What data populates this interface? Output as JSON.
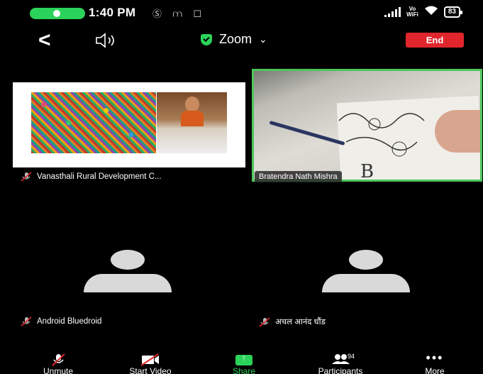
{
  "status_bar": {
    "time": "1:40 PM",
    "left_icons": "Ⓢ ⩋ ☐",
    "vowifi_top": "Vo",
    "vowifi_bottom": "WiFi",
    "battery": "83"
  },
  "header": {
    "title": "Zoom",
    "end_label": "End",
    "accent_green": "#2bd35a",
    "end_red": "#e0262c"
  },
  "tiles": [
    {
      "name": "Vanasthali Rural Development C...",
      "muted": true,
      "active_speaker": false
    },
    {
      "name": "Bratendra Nath Mishra",
      "muted": false,
      "active_speaker": true
    },
    {
      "name": "Android Bluedroid",
      "muted": true,
      "video_off": true
    },
    {
      "name": "अचल आनंद धौंड",
      "muted": true,
      "video_off": true
    }
  ],
  "toolbar": {
    "unmute": "Unmute",
    "start_video": "Start Video",
    "share": "Share",
    "participants": "Participants",
    "participants_count": "94",
    "more": "More"
  },
  "icons": [
    "microphone-icon",
    "back-chevron-icon",
    "speaker-icon",
    "shield-icon",
    "chevron-down-icon",
    "muted-mic-icon",
    "video-off-icon",
    "share-icon",
    "participants-icon",
    "more-icon"
  ]
}
